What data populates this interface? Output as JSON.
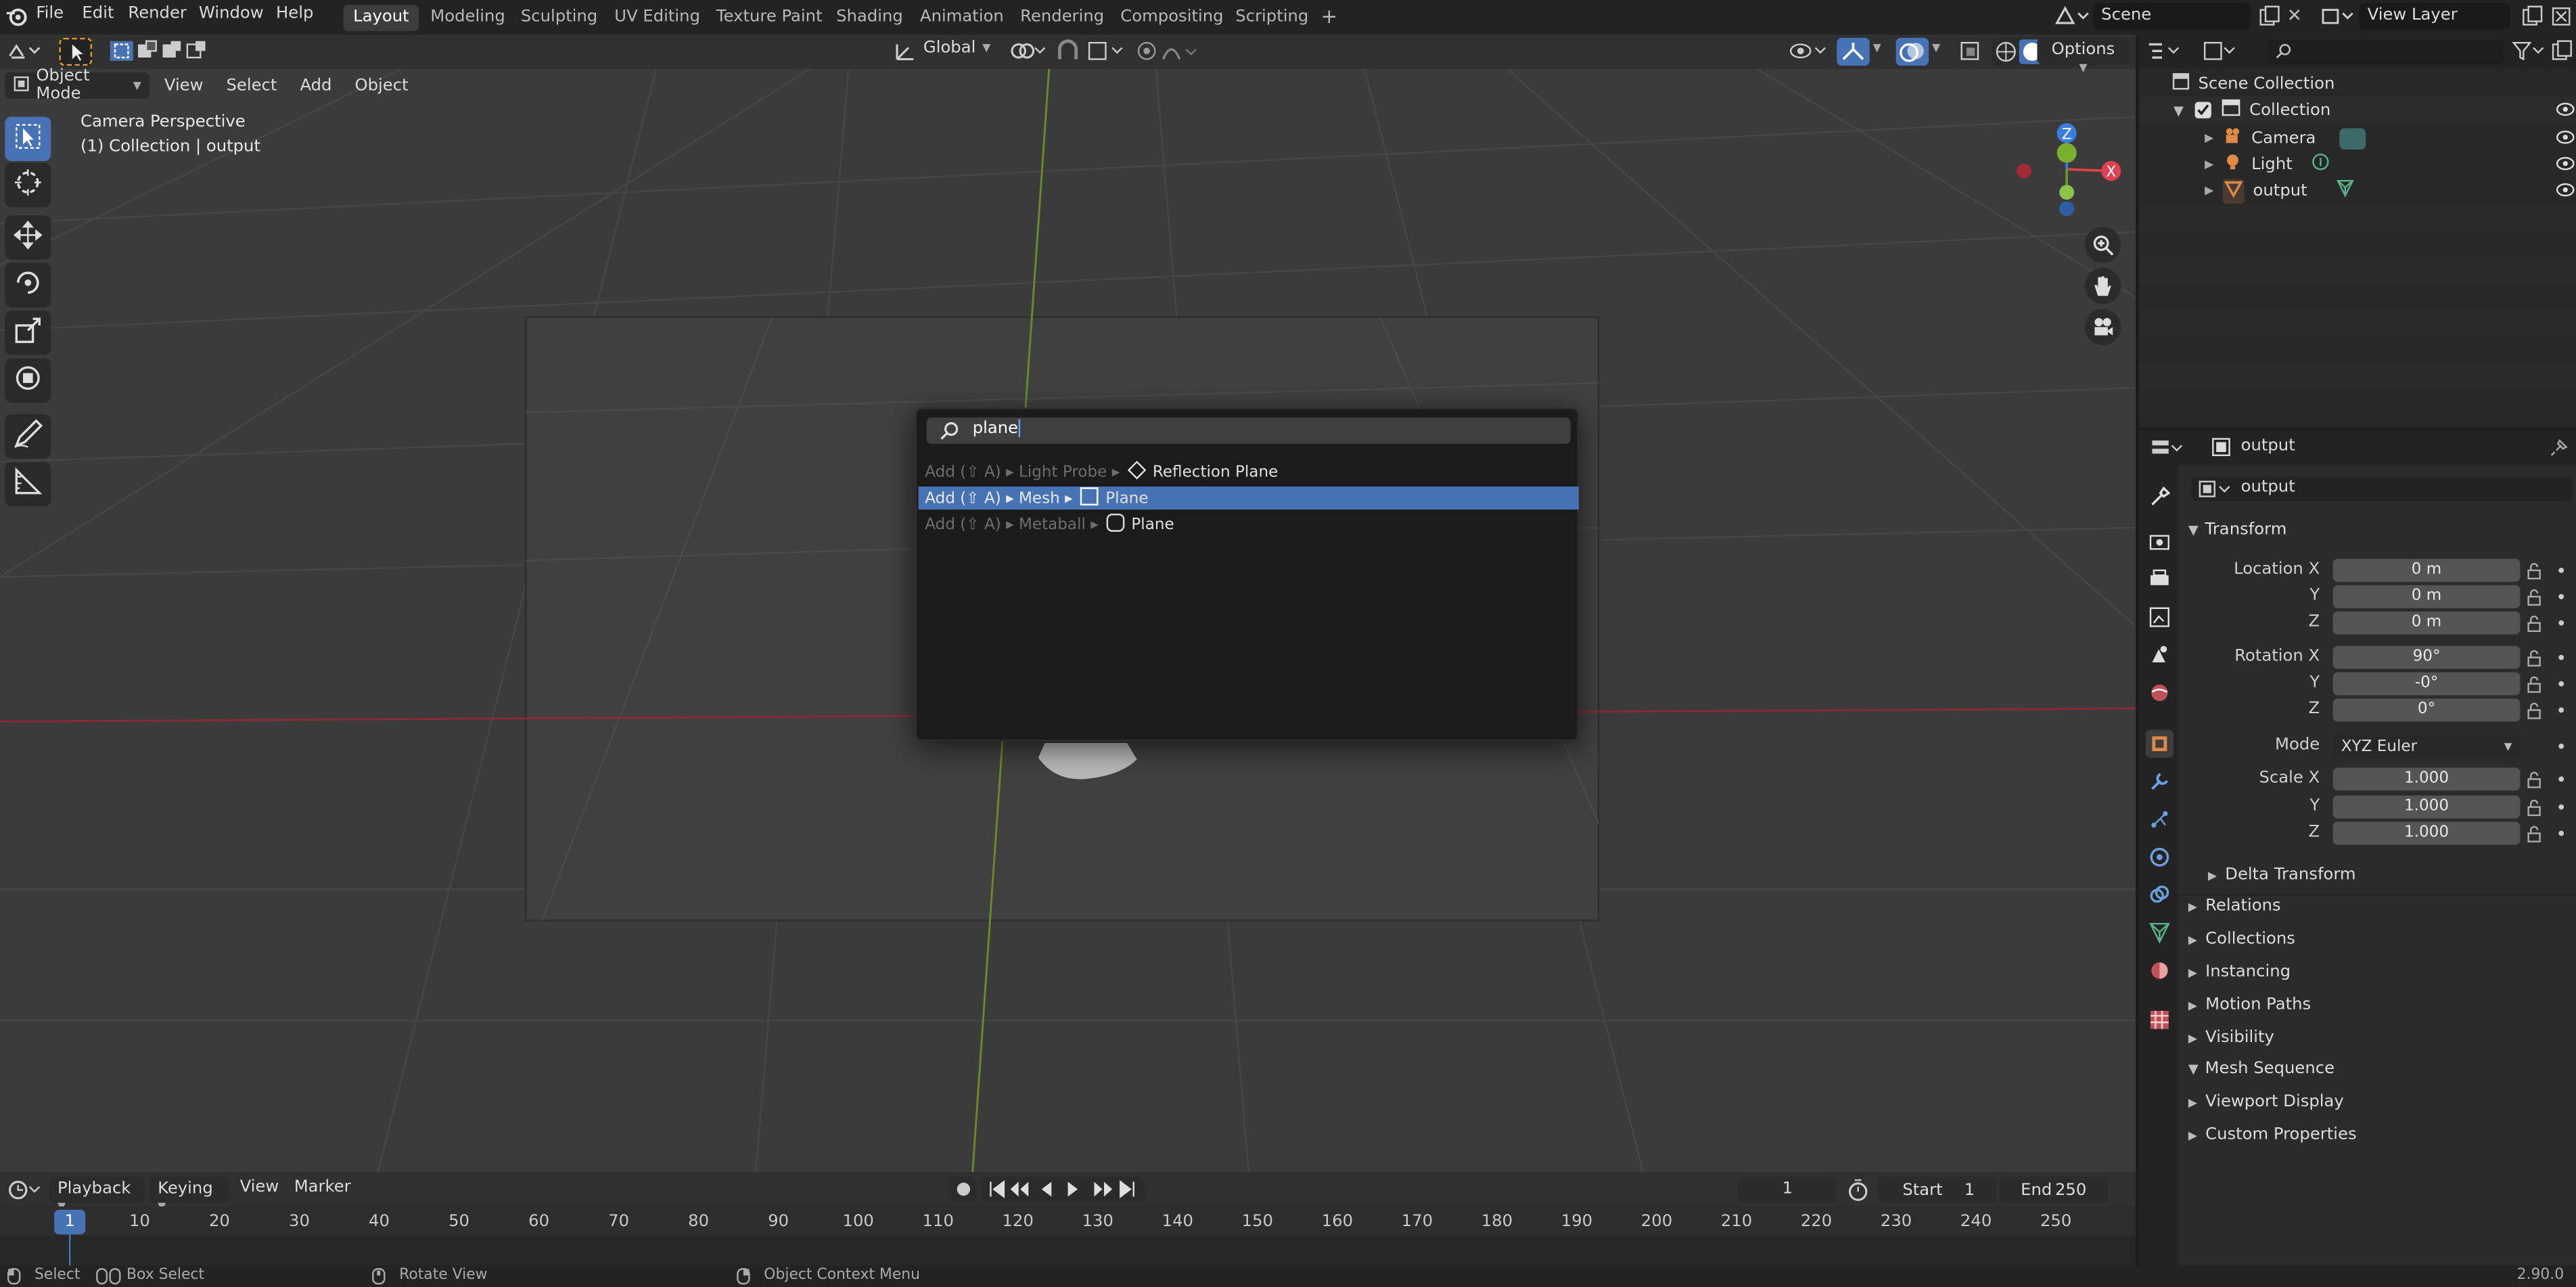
{
  "topbar": {
    "menus": [
      "File",
      "Edit",
      "Render",
      "Window",
      "Help"
    ],
    "workspaces": [
      "Layout",
      "Modeling",
      "Sculpting",
      "UV Editing",
      "Texture Paint",
      "Shading",
      "Animation",
      "Rendering",
      "Compositing",
      "Scripting"
    ],
    "active_workspace": "Layout",
    "add_tab": "+",
    "scene": "Scene",
    "view_layer": "View Layer"
  },
  "viewport": {
    "mode": "Object Mode",
    "menus": [
      "View",
      "Select",
      "Add",
      "Object"
    ],
    "orientation": "Global",
    "options_label": "Options",
    "overlay_title": "Camera Perspective",
    "overlay_subtitle": "(1) Collection | output",
    "gizmo_x": "X",
    "gizmo_y": "Y",
    "gizmo_z": "Z"
  },
  "search_popup": {
    "query": "plane",
    "results": [
      {
        "path": "Add (⇧ A) ▸ Light Probe ▸",
        "name": "Reflection Plane",
        "icon": "diamond-icon",
        "selected": false
      },
      {
        "path": "Add (⇧ A) ▸ Mesh ▸",
        "name": "Plane",
        "icon": "mesh-plane-icon",
        "selected": true
      },
      {
        "path": "Add (⇧ A) ▸ Metaball ▸",
        "name": "Plane",
        "icon": "metaball-plane-icon",
        "selected": false
      }
    ]
  },
  "outliner": {
    "root": "Scene Collection",
    "collection": "Collection",
    "items": [
      {
        "label": "Camera",
        "icon": "camera-icon"
      },
      {
        "label": "Light",
        "icon": "light-icon"
      },
      {
        "label": "output",
        "icon": "mesh-icon"
      }
    ]
  },
  "properties": {
    "object_name": "output",
    "name_field": "output",
    "transform_title": "Transform",
    "location_label": "Location X",
    "y_label": "Y",
    "z_label": "Z",
    "location": [
      "0 m",
      "0 m",
      "0 m"
    ],
    "rotation_label": "Rotation X",
    "rotation": [
      "90°",
      "-0°",
      "0°"
    ],
    "mode_label": "Mode",
    "mode_value": "XYZ Euler",
    "scale_label": "Scale X",
    "scale": [
      "1.000",
      "1.000",
      "1.000"
    ],
    "delta_transform": "Delta Transform",
    "sections": [
      {
        "label": "Relations",
        "open": false
      },
      {
        "label": "Collections",
        "open": false
      },
      {
        "label": "Instancing",
        "open": false
      },
      {
        "label": "Motion Paths",
        "open": false
      },
      {
        "label": "Visibility",
        "open": false
      },
      {
        "label": "Mesh Sequence",
        "open": true
      },
      {
        "label": "Viewport Display",
        "open": false
      },
      {
        "label": "Custom Properties",
        "open": false
      }
    ]
  },
  "timeline": {
    "menus": [
      "Playback",
      "Keying",
      "View",
      "Marker"
    ],
    "current_frame": "1",
    "start_label": "Start",
    "start": "1",
    "end_label": "End",
    "end": "250",
    "ticks": [
      "10",
      "20",
      "30",
      "40",
      "50",
      "60",
      "70",
      "80",
      "90",
      "100",
      "110",
      "120",
      "130",
      "140",
      "150",
      "160",
      "170",
      "180",
      "190",
      "200",
      "210",
      "220",
      "230",
      "240",
      "250"
    ],
    "playhead": "1"
  },
  "statusbar": {
    "select": "Select",
    "box_select": "Box Select",
    "rotate_view": "Rotate View",
    "context_menu": "Object Context Menu",
    "version": "2.90.0"
  }
}
